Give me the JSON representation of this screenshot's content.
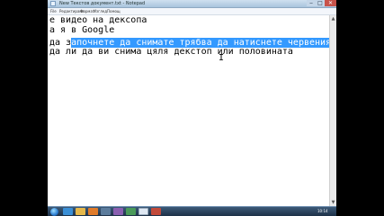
{
  "window": {
    "title": "New Текстов документ.txt - Notepad",
    "min_glyph": "‒",
    "max_glyph": "□",
    "close_glyph": "✕"
  },
  "menu": [
    "File",
    "Редактиране",
    "Формат",
    "Изглед",
    "Помощ"
  ],
  "editor": {
    "lines": [
      "е видео на дексопа",
      "а я в Google",
      "",
      "да з",
      "апочнете да снимате трябва да натиснете червеният",
      "да ли да ви снима цяля декстоп или половината"
    ],
    "cursor_glyph": "I"
  },
  "scrollbar": {
    "up_glyph": "▲",
    "down_glyph": "▼"
  },
  "taskbar": {
    "icon_names": [
      "start-orb",
      "ie-icon",
      "folder-icon",
      "media-player-icon",
      "app-icon",
      "app-icon",
      "app-icon",
      "notepad-icon",
      "recorder-icon"
    ],
    "clock": "10:14"
  },
  "colors": {
    "selection": "#3399ff",
    "desktop": "#6a8fb0",
    "taskbar": "#1d3148"
  }
}
